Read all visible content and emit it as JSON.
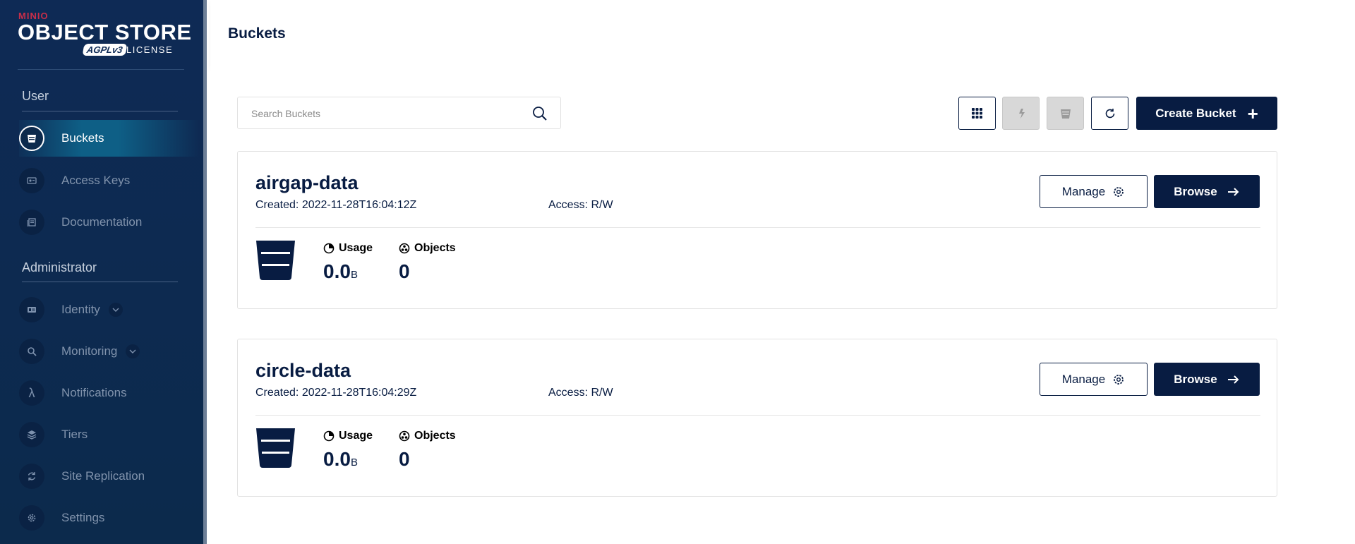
{
  "app": {
    "brand_small": "MINIO",
    "brand_main": "OBJECT STORE",
    "license_badge": "AGPLv3",
    "license_label": "LICENSE"
  },
  "sidebar": {
    "user_section": "User",
    "admin_section": "Administrator",
    "user_items": [
      {
        "label": "Buckets",
        "icon": "bucket-icon",
        "active": true
      },
      {
        "label": "Access Keys",
        "icon": "key-icon"
      },
      {
        "label": "Documentation",
        "icon": "docs-icon"
      }
    ],
    "admin_items": [
      {
        "label": "Identity",
        "icon": "identity-icon",
        "expandable": true
      },
      {
        "label": "Monitoring",
        "icon": "monitoring-icon",
        "expandable": true
      },
      {
        "label": "Notifications",
        "icon": "lambda-icon"
      },
      {
        "label": "Tiers",
        "icon": "tiers-icon"
      },
      {
        "label": "Site Replication",
        "icon": "replication-icon"
      },
      {
        "label": "Settings",
        "icon": "gear-icon"
      }
    ]
  },
  "header": {
    "title": "Buckets"
  },
  "toolbar": {
    "search_placeholder": "Search Buckets",
    "create_label": "Create Bucket"
  },
  "buckets": [
    {
      "name": "airgap-data",
      "created": "Created: 2022-11-28T16:04:12Z",
      "access": "Access: R/W",
      "manage_label": "Manage",
      "browse_label": "Browse",
      "usage_label": "Usage",
      "usage_value": "0.0",
      "usage_unit": "B",
      "objects_label": "Objects",
      "objects_value": "0"
    },
    {
      "name": "circle-data",
      "created": "Created: 2022-11-28T16:04:29Z",
      "access": "Access: R/W",
      "manage_label": "Manage",
      "browse_label": "Browse",
      "usage_label": "Usage",
      "usage_value": "0.0",
      "usage_unit": "B",
      "objects_label": "Objects",
      "objects_value": "0"
    }
  ],
  "colors": {
    "primary": "#081c42",
    "sidebar_bg": "#0e2a55",
    "active_highlight": "#0e5f86",
    "brand_red": "#c72e49"
  }
}
